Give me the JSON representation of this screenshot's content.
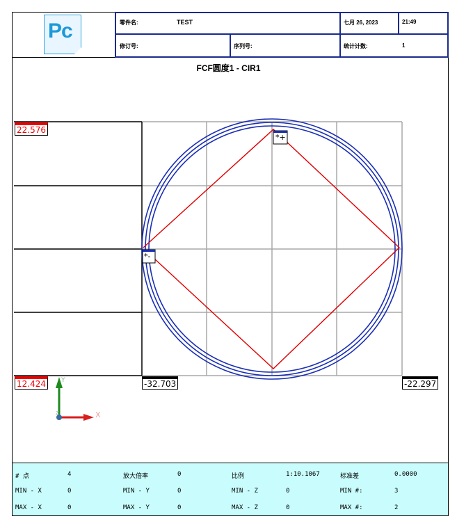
{
  "header": {
    "logo_text": "Pc",
    "part_name_label": "零件名:",
    "part_name_value": "TEST",
    "date": "七月 26, 2023",
    "time": "21:49",
    "revision_label": "修订号:",
    "serial_label": "序列号:",
    "stat_count_label": "统计计数:",
    "stat_count_value": "1"
  },
  "plot": {
    "title": "FCF圆度1 - CIR1",
    "y_max_label": "22.576",
    "y_min_label": "12.424",
    "x_min_label": "-32.703",
    "x_max_label": "-22.297",
    "max_marker": "*+",
    "min_marker": "*-",
    "axis_y_label": "Y",
    "axis_x_label": "X",
    "axis_z_label": "Z",
    "colors": {
      "circle": "#1a2fb5",
      "deviation": "#e00000",
      "grid": "#a8a8a8",
      "axis_y": "#1e8a1e",
      "axis_x": "#d81e1e"
    }
  },
  "footer": {
    "rows": [
      [
        {
          "k": "# 点",
          "v": "4"
        },
        {
          "k": "放大倍率",
          "v": "0"
        },
        {
          "k": "比例",
          "v": "1:10.1067"
        },
        {
          "k": "标准差",
          "v": "0.0000"
        }
      ],
      [
        {
          "k": "MIN - X",
          "v": "0"
        },
        {
          "k": "MIN - Y",
          "v": "0"
        },
        {
          "k": "MIN - Z",
          "v": "0"
        },
        {
          "k": "MIN #:",
          "v": "3"
        }
      ],
      [
        {
          "k": "MAX - X",
          "v": "0"
        },
        {
          "k": "MAX - Y",
          "v": "0"
        },
        {
          "k": "MAX - Z",
          "v": "0"
        },
        {
          "k": "MAX #:",
          "v": "2"
        }
      ]
    ]
  }
}
